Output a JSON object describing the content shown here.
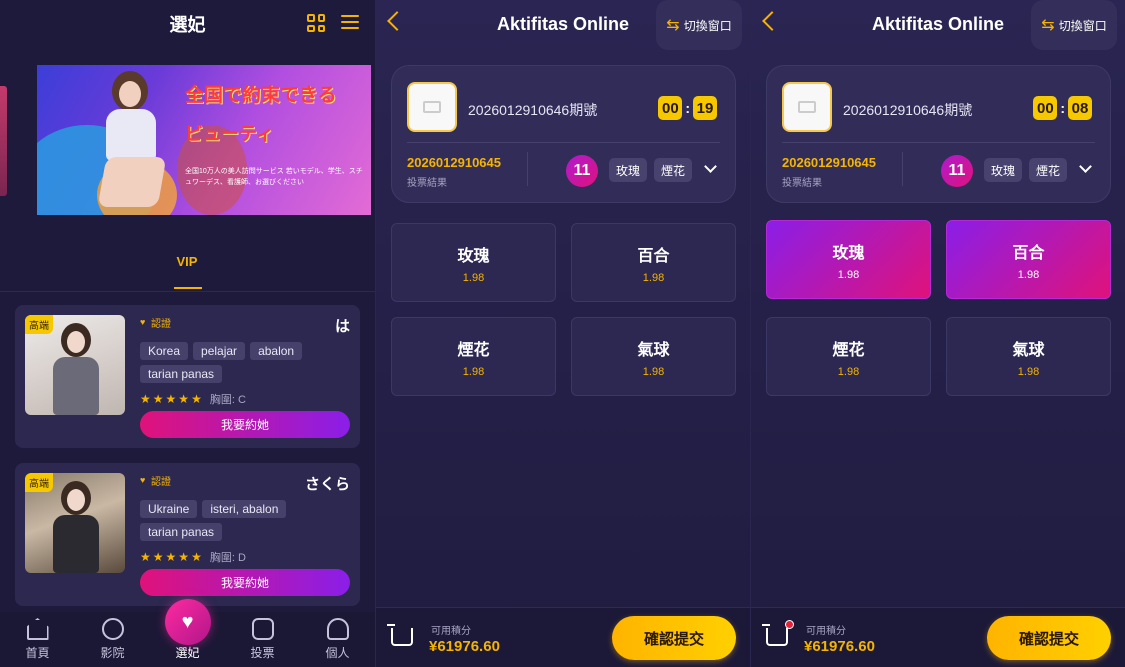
{
  "panel1": {
    "title": "選妃",
    "banner": {
      "line1": "全国で約束できる",
      "line2": "ビューティ",
      "line3": "全国10万人の美人訪問サービス 若いモデル、学生、スチュワーデス、看護師、お選びください"
    },
    "tab": "VIP",
    "cards": [
      {
        "hot": "高端",
        "verified": "認證",
        "name": "は",
        "tags": [
          "Korea",
          "pelajar",
          "abalon",
          "tarian panas"
        ],
        "bust": "胸圍: C",
        "stars": 5,
        "button": "我要約她"
      },
      {
        "hot": "高端",
        "verified": "認證",
        "name": "さくら",
        "tags": [
          "Ukraine",
          "isteri, abalon",
          "tarian panas"
        ],
        "bust": "胸圍: D",
        "stars": 5,
        "button": "我要約她"
      }
    ],
    "nav": [
      "首頁",
      "影院",
      "選妃",
      "投票",
      "個人"
    ]
  },
  "game": {
    "title": "Aktifitas Online",
    "switch": "切換窗口",
    "issue": "2026012910646期號",
    "last_issue": "2026012910645",
    "last_label": "投票結果",
    "result_number": "11",
    "result_tags": [
      "玫瑰",
      "煙花"
    ],
    "options": [
      {
        "name": "玫瑰",
        "odds": "1.98"
      },
      {
        "name": "百合",
        "odds": "1.98"
      },
      {
        "name": "煙花",
        "odds": "1.98"
      },
      {
        "name": "氣球",
        "odds": "1.98"
      }
    ],
    "balance_label": "可用積分",
    "balance": "¥61976.60",
    "submit": "確認提交"
  },
  "panel2": {
    "cd_min": "00",
    "cd_sec": "19"
  },
  "panel3": {
    "cd_min": "00",
    "cd_sec": "08",
    "selected": [
      "玫瑰",
      "百合"
    ]
  },
  "colors": {
    "accent": "#f5b400",
    "bg": "#1e1a3c",
    "pink": "#e0127a",
    "purple": "#8a1ee8"
  }
}
